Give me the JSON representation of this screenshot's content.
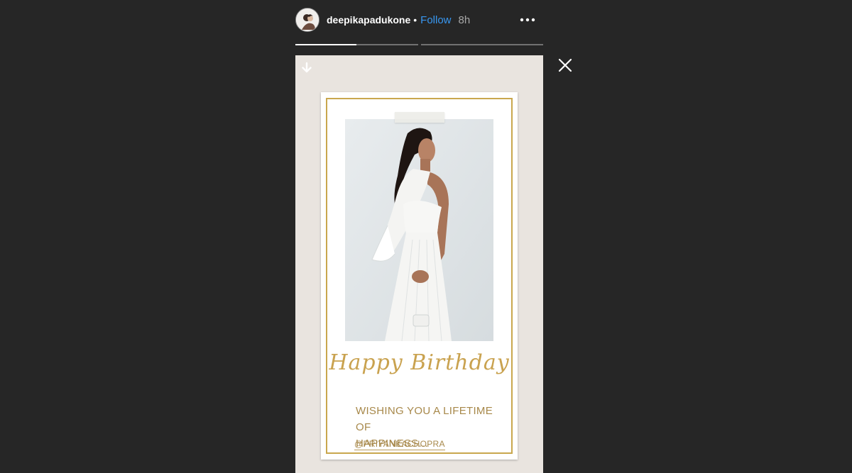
{
  "header": {
    "username": "deepikapadukone",
    "separator": "•",
    "follow_label": "Follow",
    "time": "8h",
    "more_icon": "more-horizontal-icon"
  },
  "progress": {
    "segments": 2,
    "active_index": 0,
    "active_fraction": 0.5
  },
  "story": {
    "download_icon": "arrow-down-icon",
    "card": {
      "greeting": "Happy Birthday",
      "wish_line1": "WISHING YOU A LIFETIME OF",
      "wish_line2": "HAPPINESS...",
      "mention": "@PRIYANKACHOPRA"
    }
  },
  "close_icon": "close-icon",
  "colors": {
    "background": "#262626",
    "follow": "#3897f0",
    "gold": "#c9a74e",
    "wish_text": "#a7884a"
  }
}
